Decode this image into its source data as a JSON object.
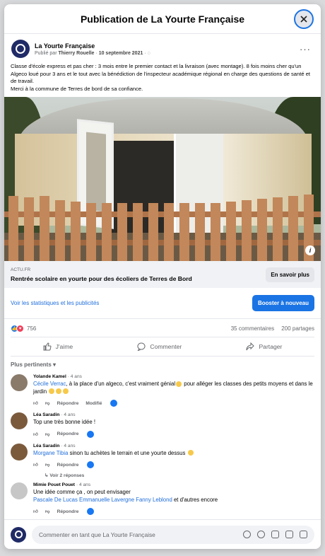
{
  "modal": {
    "title": "Publication de La Yourte Française",
    "close_icon": "close-icon"
  },
  "post": {
    "page_name": "La Yourte Française",
    "published_by_prefix": "Publié par",
    "author": "Thierry Rouelle",
    "date": "10 septembre 2021",
    "text_lines": [
      "Classe d'école express et pas cher : 3 mois entre le premier contact et la livraison (avec montage). 8 fois moins cher qu'un Algeco loué pour 3 ans et le tout avec la bénédiction de l'inspecteur académique régional en charge des questions de santé et de travail.",
      "Merci à la commune de Terres de bord de sa confiance."
    ],
    "link": {
      "domain": "ACTU.FR",
      "title": "Rentrée scolaire en yourte pour des écoliers de Terres de Bord",
      "button": "En savoir plus"
    },
    "promo": {
      "stats_link": "Voir les statistiques et les publicités",
      "boost_button": "Booster à nouveau"
    },
    "reactions": {
      "count": "756",
      "comments": "35 commentaires",
      "shares": "200 partages"
    },
    "actions": {
      "like": "J'aime",
      "comment": "Commenter",
      "share": "Partager"
    }
  },
  "comments_section": {
    "filter": "Plus pertinents",
    "comments": [
      {
        "author": "Yolande Kamel",
        "time": "· 4 ans",
        "mention": "Cécile Verrac",
        "text": ", à la place d'un algeco, c'est vraiment génial",
        "text2": " pour alléger les classes des petits moyens et dans le jardin",
        "reply": "Répondre",
        "edited": "Modifié"
      },
      {
        "author": "Léa Saradin",
        "time": "· 4 ans",
        "text": "Top une très bonne idée !",
        "reply": "Répondre"
      },
      {
        "author": "Léa Saradin",
        "time": "· 4 ans",
        "mention": "Morgane Tibia",
        "text": " sinon tu achètes le terrain et une yourte dessus",
        "reply": "Répondre",
        "replies": "Voir 2 réponses"
      },
      {
        "author": "Mimie Pouet Pouet",
        "time": "· 4 ans",
        "text": "Une idée comme ça , on peut envisager",
        "mention": "Pascale De Lucas Emmanuelle Lavergne Fanny Leblond",
        "text2": " et d'autres encore",
        "reply": "Répondre"
      }
    ]
  },
  "composer": {
    "placeholder": "Commenter en tant que La Yourte Française"
  },
  "colors": {
    "brand_blue": "#1b74e4",
    "link_blue": "#216fdb"
  }
}
